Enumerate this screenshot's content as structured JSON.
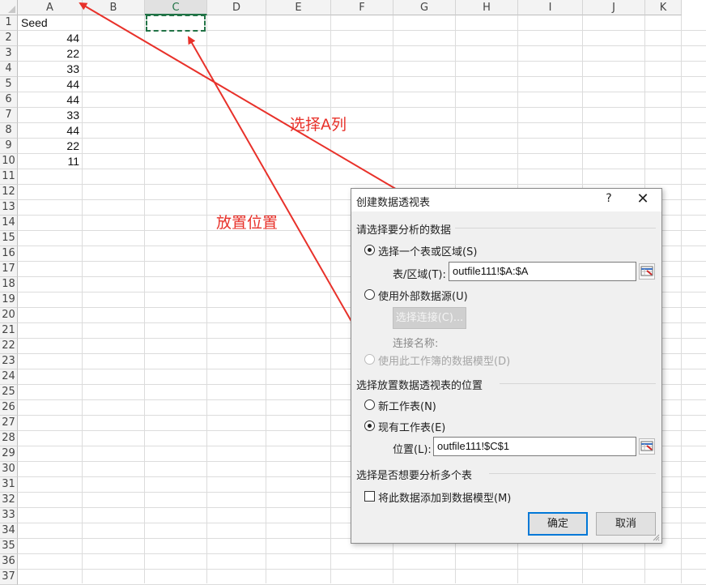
{
  "sheet": {
    "columns": [
      "A",
      "B",
      "C",
      "D",
      "E",
      "F",
      "G",
      "H",
      "I",
      "J",
      "K"
    ],
    "selected_column": "C",
    "rows": [
      "1",
      "2",
      "3",
      "4",
      "5",
      "6",
      "7",
      "8",
      "9",
      "10",
      "11",
      "12",
      "13",
      "14",
      "15",
      "16",
      "17",
      "18",
      "19",
      "20",
      "21",
      "22",
      "23",
      "24",
      "25",
      "26",
      "27",
      "28",
      "29",
      "30",
      "31",
      "32",
      "33",
      "34",
      "35",
      "36",
      "37"
    ],
    "column_a_header": "Seed",
    "column_a_values": [
      "44",
      "22",
      "33",
      "44",
      "44",
      "33",
      "44",
      "22",
      "11"
    ],
    "selected_cell": "C1"
  },
  "annotations": {
    "label_select_column": "选择A列",
    "label_placement": "放置位置",
    "color": "#e8312a"
  },
  "dialog": {
    "title": "创建数据透视表",
    "help": "?",
    "close": "✕",
    "section_choose_data": "请选择要分析的数据",
    "opt_table_range": "选择一个表或区域(S)",
    "table_range_label": "表/区域(T):",
    "table_range_value": "outfile111!$A:$A",
    "opt_external": "使用外部数据源(U)",
    "choose_connection_button": "选择连接(C)...",
    "connection_name_label": "连接名称:",
    "opt_data_model": "使用此工作簿的数据模型(D)",
    "section_location": "选择放置数据透视表的位置",
    "opt_new_sheet": "新工作表(N)",
    "opt_existing_sheet": "现有工作表(E)",
    "location_label": "位置(L):",
    "location_value": "outfile111!$C$1",
    "section_multiple": "选择是否想要分析多个表",
    "add_to_model": "将此数据添加到数据模型(M)",
    "ok_button": "确定",
    "cancel_button": "取消",
    "selected_option_data": "选择一个表或区域(S)",
    "selected_option_location": "现有工作表(E)",
    "add_to_model_checked": false
  }
}
